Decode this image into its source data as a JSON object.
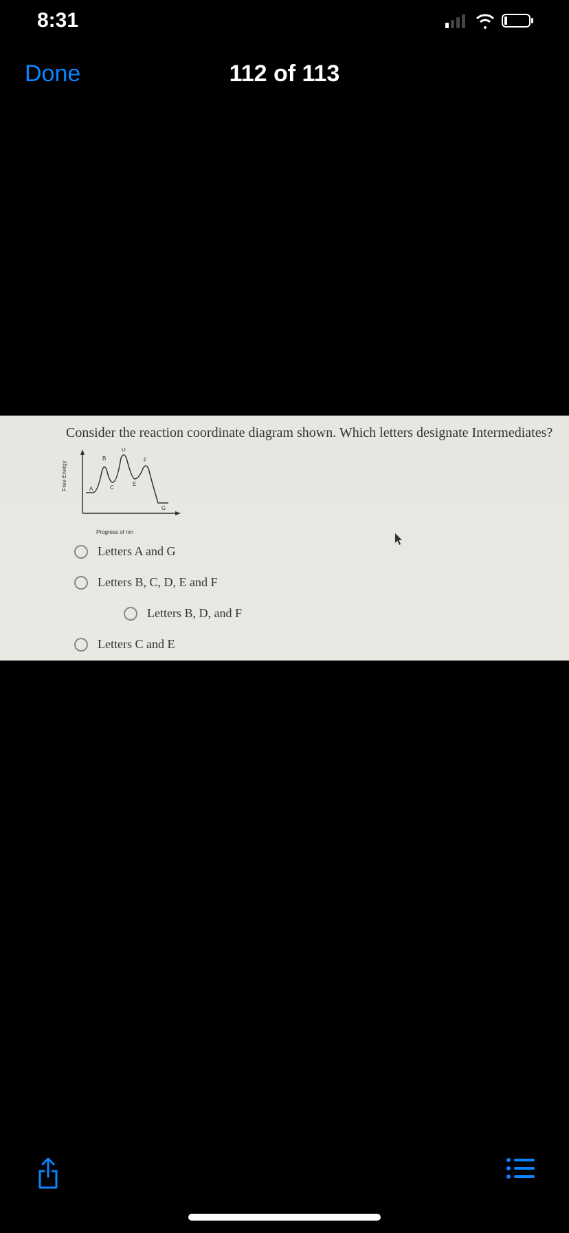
{
  "status_bar": {
    "time": "8:31"
  },
  "nav": {
    "done_label": "Done",
    "page_counter": "112 of 113"
  },
  "question": {
    "prompt": "Consider the reaction coordinate diagram shown.  Which letters designate Intermediates?",
    "diagram": {
      "ylabel": "Free Energy",
      "xlabel": "Progress of rxn",
      "point_labels": [
        "A",
        "B",
        "C",
        "D",
        "E",
        "F",
        "G"
      ]
    },
    "options": [
      "Letters A and G",
      "Letters B, C, D, E and F",
      "Letters B, D, and F",
      "Letters C and E"
    ]
  },
  "chart_data": {
    "type": "line",
    "title": "",
    "xlabel": "Progress of rxn",
    "ylabel": "Free Energy",
    "x": [
      0,
      1,
      2,
      3,
      4,
      5,
      6
    ],
    "values": [
      30,
      55,
      35,
      70,
      40,
      50,
      10
    ],
    "point_labels": [
      "A",
      "B",
      "C",
      "D",
      "E",
      "F",
      "G"
    ],
    "ylim": [
      0,
      80
    ]
  }
}
